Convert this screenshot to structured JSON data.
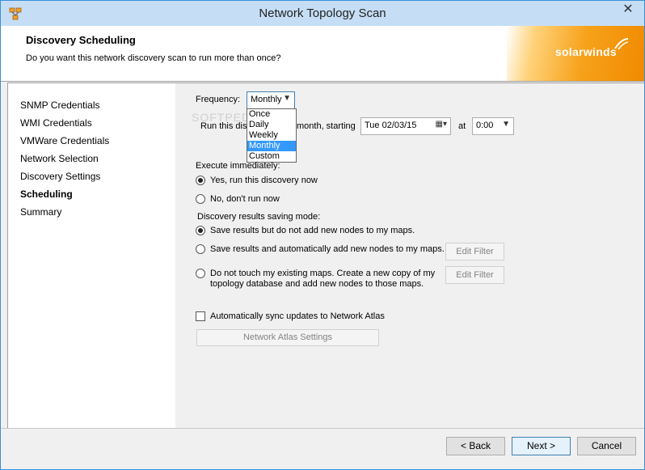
{
  "window": {
    "title": "Network Topology Scan",
    "close_glyph": "✕"
  },
  "header": {
    "title": "Discovery Scheduling",
    "subtitle": "Do you want this network discovery scan to run more than once?",
    "brand": "solarwinds"
  },
  "nav": {
    "items": [
      {
        "label": "SNMP Credentials"
      },
      {
        "label": "WMI Credentials"
      },
      {
        "label": "VMWare Credentials"
      },
      {
        "label": "Network Selection"
      },
      {
        "label": "Discovery Settings"
      },
      {
        "label": "Scheduling"
      },
      {
        "label": "Summary"
      }
    ],
    "active": "Scheduling"
  },
  "schedule": {
    "frequency_label": "Frequency:",
    "frequency_value": "Monthly",
    "frequency_options": [
      "Once",
      "Daily",
      "Weekly",
      "Monthly",
      "Custom"
    ],
    "run_text_left": "Run this disco",
    "run_text_right": "month, starting",
    "date_value": "Tue  02/03/15",
    "at_label": "at",
    "time_value": "0:00"
  },
  "execute": {
    "label": "Execute immediately:",
    "yes": "Yes, run this discovery now",
    "no": "No, don't run now"
  },
  "saving": {
    "label": "Discovery results saving mode:",
    "opt1": "Save results but do not add new nodes to my maps.",
    "opt2": "Save results and automatically add new nodes to my maps.",
    "opt3_line1": "Do not touch my existing maps. Create a new copy of my",
    "opt3_line2": "topology database and add new nodes to those maps.",
    "edit_filter": "Edit Filter"
  },
  "sync": {
    "label": "Automatically sync updates to Network Atlas",
    "settings_button": "Network Atlas Settings"
  },
  "footer": {
    "back": "< Back",
    "next": "Next >",
    "cancel": "Cancel"
  },
  "watermark": "SOFTPEDIA",
  "colors": {
    "accent": "#3399ff",
    "brand_orange": "#f08a00",
    "title_bar": "#c5def5"
  }
}
